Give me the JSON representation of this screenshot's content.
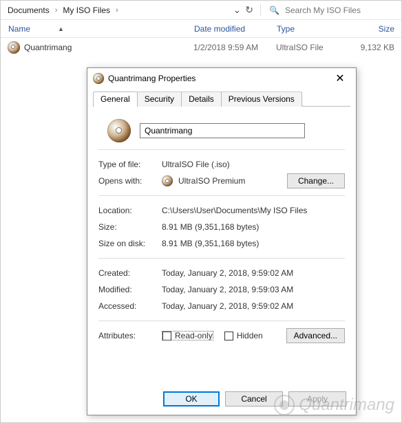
{
  "explorer": {
    "crumb1": "Documents",
    "crumb2": "My ISO Files",
    "search_placeholder": "Search My ISO Files",
    "cols": {
      "name": "Name",
      "date": "Date modified",
      "type": "Type",
      "size": "Size"
    },
    "row": {
      "name": "Quantrimang",
      "date": "1/2/2018 9:59 AM",
      "type": "UltraISO File",
      "size": "9,132 KB"
    }
  },
  "dialog": {
    "title": "Quantrimang Properties",
    "tabs": {
      "general": "General",
      "security": "Security",
      "details": "Details",
      "prev": "Previous Versions"
    },
    "filename": "Quantrimang",
    "labels": {
      "typeoffile": "Type of file:",
      "openswith": "Opens with:",
      "change": "Change...",
      "location": "Location:",
      "size": "Size:",
      "sizeondisk": "Size on disk:",
      "created": "Created:",
      "modified": "Modified:",
      "accessed": "Accessed:",
      "attributes": "Attributes:",
      "readonly": "Read-only",
      "hidden": "Hidden",
      "advanced": "Advanced..."
    },
    "values": {
      "typeoffile": "UltraISO File (.iso)",
      "openswith": "UltraISO Premium",
      "location": "C:\\Users\\User\\Documents\\My ISO Files",
      "size": "8.91 MB (9,351,168 bytes)",
      "sizeondisk": "8.91 MB (9,351,168 bytes)",
      "created": "Today, January 2, 2018, 9:59:02 AM",
      "modified": "Today, January 2, 2018, 9:59:03 AM",
      "accessed": "Today, January 2, 2018, 9:59:02 AM"
    },
    "buttons": {
      "ok": "OK",
      "cancel": "Cancel",
      "apply": "Apply"
    }
  },
  "watermark": "Quantrimang"
}
